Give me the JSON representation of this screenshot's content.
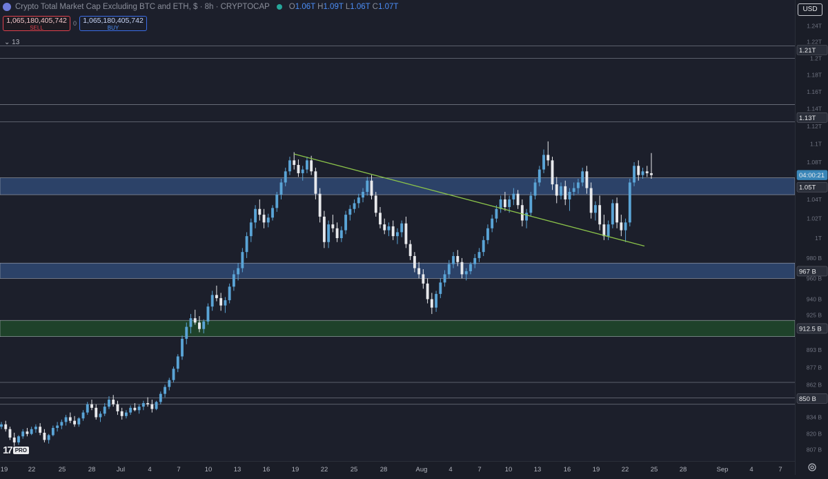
{
  "header": {
    "title": "Crypto Total Market Cap Excluding BTC and ETH, $ · 8h · CRYPTOCAP",
    "ohlc": {
      "open_label": "O",
      "open": "1.06T",
      "high_label": "H",
      "high": "1.09T",
      "low_label": "L",
      "low": "1.06T",
      "close_label": "C",
      "close": "1.07T"
    }
  },
  "trade": {
    "sell_value": "1,065,180,405,742",
    "sell_label": "SELL",
    "spread": "0",
    "buy_value": "1,065,180,405,742",
    "buy_label": "BUY"
  },
  "indicators_toggle": "13",
  "branding": {
    "mark": "17",
    "badge": "PRO"
  },
  "currency_button": "USD",
  "colors": {
    "up": "#5aa4d6",
    "down": "#e8e9ec",
    "blue_zone": "#3b5f9a",
    "green_zone": "#1f5a2a",
    "trendline": "#8bc34a"
  },
  "chart_data": {
    "type": "candlestick",
    "y_scale": "log",
    "ylim": [
      800000000000,
      1250000000000
    ],
    "y_tick_labels": [
      "1.24T",
      "1.22T",
      "1.2T",
      "1.18T",
      "1.16T",
      "1.14T",
      "1.12T",
      "1.1T",
      "1.08T",
      "1.04T",
      "1.02T",
      "1T",
      "980 B",
      "960 B",
      "940 B",
      "925 B",
      "893 B",
      "877 B",
      "862 B",
      "834 B",
      "820 B",
      "807 B"
    ],
    "y_ticks": [
      1240,
      1220,
      1200,
      1180,
      1160,
      1140,
      1120,
      1100,
      1080,
      1040,
      1020,
      1000,
      980,
      960,
      940,
      925,
      893,
      877,
      862,
      834,
      820,
      807
    ],
    "price_labels": [
      {
        "text": "1.21T",
        "value": 1210,
        "style": "line"
      },
      {
        "text": "1.13T",
        "value": 1130,
        "style": "line"
      },
      {
        "text": "04:00:21",
        "value": 1066,
        "style": "current"
      },
      {
        "text": "1.05T",
        "value": 1053,
        "style": "line"
      },
      {
        "text": "967 B",
        "value": 967,
        "style": "line"
      },
      {
        "text": "912.5 B",
        "value": 912.5,
        "style": "line"
      },
      {
        "text": "850 B",
        "value": 850,
        "style": "line"
      }
    ],
    "x_tick_labels": [
      "19",
      "22",
      "25",
      "28",
      "Jul",
      "4",
      "7",
      "10",
      "13",
      "16",
      "19",
      "22",
      "25",
      "28",
      "Aug",
      "4",
      "7",
      "10",
      "13",
      "16",
      "19",
      "22",
      "25",
      "28",
      "Sep",
      "4",
      "7"
    ],
    "zones": [
      {
        "kind": "blue",
        "from": 1045,
        "to": 1063
      },
      {
        "kind": "blue",
        "from": 960,
        "to": 975
      },
      {
        "kind": "green",
        "from": 905,
        "to": 920
      }
    ],
    "horizontal_lines": [
      1215,
      1200,
      1145,
      1125,
      864,
      850.5,
      845
    ],
    "trendline": {
      "from": {
        "date": "Jul 21",
        "value": 1089
      },
      "to": {
        "date": "Aug 24",
        "value": 992
      }
    },
    "candles": [
      [
        826,
        830,
        824,
        828
      ],
      [
        828,
        831,
        822,
        824
      ],
      [
        824,
        826,
        815,
        817
      ],
      [
        817,
        821,
        810,
        813
      ],
      [
        813,
        819,
        811,
        818
      ],
      [
        818,
        824,
        816,
        822
      ],
      [
        822,
        825,
        818,
        820
      ],
      [
        820,
        826,
        819,
        824
      ],
      [
        824,
        828,
        821,
        826
      ],
      [
        826,
        829,
        819,
        821
      ],
      [
        821,
        824,
        813,
        815
      ],
      [
        815,
        820,
        812,
        819
      ],
      [
        819,
        827,
        818,
        825
      ],
      [
        825,
        830,
        822,
        827
      ],
      [
        827,
        832,
        824,
        830
      ],
      [
        830,
        836,
        827,
        834
      ],
      [
        834,
        838,
        829,
        831
      ],
      [
        831,
        835,
        826,
        828
      ],
      [
        828,
        834,
        826,
        833
      ],
      [
        833,
        840,
        831,
        838
      ],
      [
        838,
        847,
        836,
        845
      ],
      [
        845,
        849,
        840,
        842
      ],
      [
        842,
        845,
        832,
        834
      ],
      [
        834,
        839,
        830,
        837
      ],
      [
        837,
        846,
        835,
        843
      ],
      [
        843,
        852,
        841,
        849
      ],
      [
        849,
        853,
        843,
        845
      ],
      [
        845,
        848,
        836,
        839
      ],
      [
        839,
        842,
        832,
        835
      ],
      [
        835,
        840,
        833,
        838
      ],
      [
        838,
        844,
        836,
        842
      ],
      [
        842,
        846,
        839,
        840
      ],
      [
        840,
        845,
        837,
        843
      ],
      [
        843,
        848,
        840,
        846
      ],
      [
        846,
        851,
        843,
        845
      ],
      [
        845,
        849,
        838,
        841
      ],
      [
        841,
        848,
        840,
        847
      ],
      [
        847,
        856,
        845,
        854
      ],
      [
        854,
        862,
        851,
        860
      ],
      [
        860,
        868,
        857,
        866
      ],
      [
        866,
        878,
        864,
        876
      ],
      [
        876,
        889,
        873,
        887
      ],
      [
        887,
        906,
        884,
        903
      ],
      [
        903,
        918,
        898,
        914
      ],
      [
        914,
        926,
        908,
        922
      ],
      [
        922,
        930,
        916,
        918
      ],
      [
        918,
        924,
        909,
        912
      ],
      [
        912,
        921,
        908,
        919
      ],
      [
        919,
        936,
        916,
        933
      ],
      [
        933,
        948,
        929,
        944
      ],
      [
        944,
        953,
        938,
        941
      ],
      [
        941,
        946,
        929,
        934
      ],
      [
        934,
        942,
        927,
        939
      ],
      [
        939,
        955,
        936,
        952
      ],
      [
        952,
        968,
        948,
        964
      ],
      [
        964,
        975,
        958,
        970
      ],
      [
        970,
        990,
        966,
        986
      ],
      [
        986,
        1006,
        980,
        1002
      ],
      [
        1002,
        1020,
        996,
        1016
      ],
      [
        1016,
        1034,
        1010,
        1030
      ],
      [
        1030,
        1040,
        1018,
        1024
      ],
      [
        1024,
        1030,
        1010,
        1016
      ],
      [
        1016,
        1025,
        1011,
        1021
      ],
      [
        1021,
        1034,
        1018,
        1031
      ],
      [
        1031,
        1048,
        1027,
        1045
      ],
      [
        1045,
        1062,
        1040,
        1058
      ],
      [
        1058,
        1074,
        1054,
        1070
      ],
      [
        1070,
        1086,
        1066,
        1082
      ],
      [
        1082,
        1091,
        1072,
        1077
      ],
      [
        1077,
        1083,
        1064,
        1068
      ],
      [
        1068,
        1076,
        1060,
        1072
      ],
      [
        1072,
        1086,
        1068,
        1082
      ],
      [
        1082,
        1087,
        1066,
        1070
      ],
      [
        1070,
        1074,
        1040,
        1046
      ],
      [
        1046,
        1052,
        1016,
        1022
      ],
      [
        1022,
        1028,
        990,
        996
      ],
      [
        996,
        1018,
        990,
        1014
      ],
      [
        1014,
        1024,
        1006,
        1010
      ],
      [
        1010,
        1016,
        996,
        1000
      ],
      [
        1000,
        1012,
        996,
        1008
      ],
      [
        1008,
        1028,
        1004,
        1024
      ],
      [
        1024,
        1034,
        1018,
        1030
      ],
      [
        1030,
        1040,
        1026,
        1036
      ],
      [
        1036,
        1046,
        1031,
        1042
      ],
      [
        1042,
        1052,
        1037,
        1048
      ],
      [
        1048,
        1064,
        1044,
        1060
      ],
      [
        1060,
        1066,
        1040,
        1044
      ],
      [
        1044,
        1048,
        1022,
        1026
      ],
      [
        1026,
        1032,
        1010,
        1014
      ],
      [
        1014,
        1020,
        1004,
        1008
      ],
      [
        1008,
        1016,
        1002,
        1012
      ],
      [
        1012,
        1018,
        998,
        1002
      ],
      [
        1002,
        1010,
        994,
        1006
      ],
      [
        1006,
        1018,
        1001,
        1015
      ],
      [
        1015,
        1022,
        990,
        994
      ],
      [
        994,
        998,
        978,
        982
      ],
      [
        982,
        986,
        966,
        970
      ],
      [
        970,
        976,
        960,
        964
      ],
      [
        964,
        969,
        950,
        955
      ],
      [
        955,
        960,
        936,
        940
      ],
      [
        940,
        946,
        926,
        932
      ],
      [
        932,
        948,
        928,
        945
      ],
      [
        945,
        960,
        941,
        956
      ],
      [
        956,
        968,
        952,
        964
      ],
      [
        964,
        978,
        960,
        974
      ],
      [
        974,
        986,
        970,
        982
      ],
      [
        982,
        988,
        972,
        976
      ],
      [
        976,
        980,
        960,
        964
      ],
      [
        964,
        970,
        958,
        967
      ],
      [
        967,
        976,
        964,
        974
      ],
      [
        974,
        984,
        970,
        980
      ],
      [
        980,
        990,
        976,
        986
      ],
      [
        986,
        1002,
        982,
        998
      ],
      [
        998,
        1014,
        994,
        1010
      ],
      [
        1010,
        1024,
        1006,
        1020
      ],
      [
        1020,
        1034,
        1016,
        1030
      ],
      [
        1030,
        1044,
        1026,
        1040
      ],
      [
        1040,
        1048,
        1028,
        1032
      ],
      [
        1032,
        1044,
        1026,
        1040
      ],
      [
        1040,
        1052,
        1034,
        1046
      ],
      [
        1046,
        1050,
        1030,
        1034
      ],
      [
        1034,
        1040,
        1012,
        1018
      ],
      [
        1018,
        1030,
        1010,
        1026
      ],
      [
        1026,
        1048,
        1022,
        1044
      ],
      [
        1044,
        1062,
        1040,
        1058
      ],
      [
        1058,
        1076,
        1054,
        1072
      ],
      [
        1072,
        1094,
        1068,
        1088
      ],
      [
        1088,
        1103,
        1076,
        1082
      ],
      [
        1082,
        1086,
        1050,
        1056
      ],
      [
        1056,
        1064,
        1036,
        1044
      ],
      [
        1044,
        1058,
        1040,
        1054
      ],
      [
        1054,
        1060,
        1034,
        1040
      ],
      [
        1040,
        1052,
        1028,
        1048
      ],
      [
        1048,
        1058,
        1044,
        1052
      ],
      [
        1052,
        1062,
        1046,
        1058
      ],
      [
        1058,
        1074,
        1054,
        1070
      ],
      [
        1070,
        1076,
        1046,
        1052
      ],
      [
        1052,
        1058,
        1020,
        1026
      ],
      [
        1026,
        1038,
        1018,
        1034
      ],
      [
        1034,
        1044,
        1008,
        1014
      ],
      [
        1014,
        1024,
        998,
        1002
      ],
      [
        1002,
        1018,
        998,
        1014
      ],
      [
        1014,
        1040,
        1010,
        1036
      ],
      [
        1036,
        1042,
        1010,
        1016
      ],
      [
        1016,
        1024,
        1002,
        1008
      ],
      [
        1008,
        1020,
        996,
        1016
      ],
      [
        1016,
        1062,
        1012,
        1058
      ],
      [
        1058,
        1080,
        1054,
        1076
      ],
      [
        1076,
        1082,
        1060,
        1066
      ],
      [
        1066,
        1074,
        1062,
        1070
      ],
      [
        1070,
        1076,
        1064,
        1068
      ],
      [
        1068,
        1090,
        1062,
        1066
      ]
    ]
  }
}
